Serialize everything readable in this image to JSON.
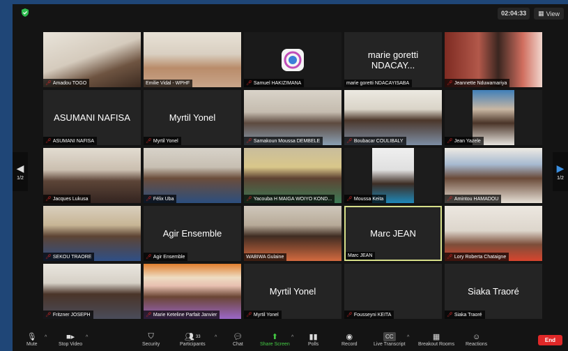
{
  "header": {
    "timer": "02:04:33",
    "view_label": "View"
  },
  "pagination": {
    "left": "1/2",
    "right": "1/2"
  },
  "tiles": [
    {
      "name": "Amadou TOGO",
      "big": "",
      "muted": true
    },
    {
      "name": "Emilie Vidal - WPHF",
      "big": "",
      "muted": false
    },
    {
      "name": "Samuel HAKIZIMANA",
      "big": "",
      "muted": true
    },
    {
      "name": "marie goretti NDACAYISABA",
      "big": "marie goretti NDACAY...",
      "muted": false
    },
    {
      "name": "Jeannette Nduwamariya",
      "big": "",
      "muted": true
    },
    {
      "name": "ASUMANI NAFISA",
      "big": "ASUMANI NAFISA",
      "muted": true
    },
    {
      "name": "Myrtil Yonel",
      "big": "Myrtil Yonel",
      "muted": true
    },
    {
      "name": "Samakoun Moussa DEMBELE",
      "big": "",
      "muted": true
    },
    {
      "name": "Boubacar COULIBALY",
      "big": "",
      "muted": true
    },
    {
      "name": "Jean Yazele",
      "big": "",
      "muted": true
    },
    {
      "name": "Jacques Lukusa",
      "big": "",
      "muted": true
    },
    {
      "name": "Félix Uba",
      "big": "",
      "muted": true
    },
    {
      "name": "Yacouba H MAIGA WOIYO KOND...",
      "big": "",
      "muted": true
    },
    {
      "name": "Moussa Keita",
      "big": "",
      "muted": true
    },
    {
      "name": "Amintou HAMADOU",
      "big": "",
      "muted": true
    },
    {
      "name": "SEKOU TRAORE",
      "big": "",
      "muted": true
    },
    {
      "name": "Agir Ensemble",
      "big": "Agir Ensemble",
      "muted": true
    },
    {
      "name": "WABIWA Gulaine",
      "big": "",
      "muted": false
    },
    {
      "name": "Marc JEAN",
      "big": "Marc JEAN",
      "muted": false
    },
    {
      "name": "Lory Roberta Chataigne",
      "big": "",
      "muted": true
    },
    {
      "name": "Fritzner JOSEPH",
      "big": "",
      "muted": true
    },
    {
      "name": "Marie Keteline Parfait Janvier",
      "big": "",
      "muted": true
    },
    {
      "name": "Myrtil Yonel",
      "big": "Myrtil Yonel",
      "muted": true
    },
    {
      "name": "Fousseyni KEITA",
      "big": "",
      "muted": true
    },
    {
      "name": "Siaka Traoré",
      "big": "Siaka Traoré",
      "muted": true
    }
  ],
  "toolbar": {
    "mute": "Mute",
    "stop_video": "Stop Video",
    "security": "Security",
    "participants": "Participants",
    "participants_count": "33",
    "chat": "Chat",
    "share_screen": "Share Screen",
    "polls": "Polls",
    "record": "Record",
    "live_transcript": "Live Transcript",
    "breakout_rooms": "Breakout Rooms",
    "reactions": "Reactions",
    "end": "End"
  }
}
